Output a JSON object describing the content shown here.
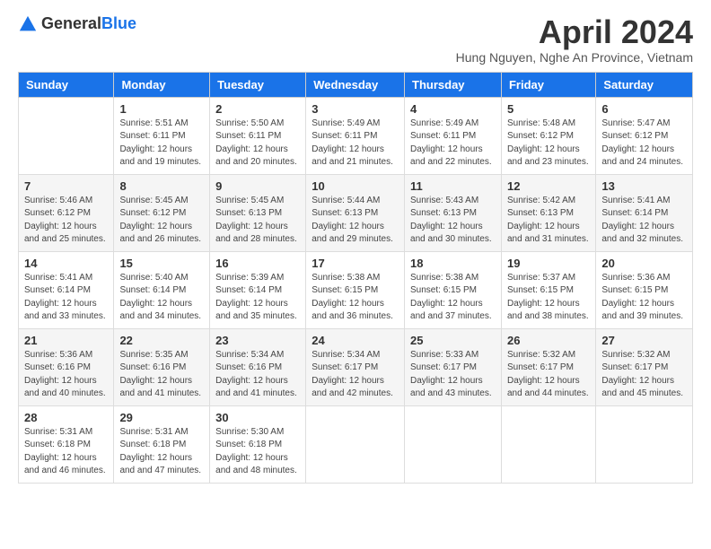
{
  "header": {
    "logo_general": "General",
    "logo_blue": "Blue",
    "month_title": "April 2024",
    "subtitle": "Hung Nguyen, Nghe An Province, Vietnam"
  },
  "weekdays": [
    "Sunday",
    "Monday",
    "Tuesday",
    "Wednesday",
    "Thursday",
    "Friday",
    "Saturday"
  ],
  "weeks": [
    [
      {
        "day": "",
        "sunrise": "",
        "sunset": "",
        "daylight": ""
      },
      {
        "day": "1",
        "sunrise": "Sunrise: 5:51 AM",
        "sunset": "Sunset: 6:11 PM",
        "daylight": "Daylight: 12 hours and 19 minutes."
      },
      {
        "day": "2",
        "sunrise": "Sunrise: 5:50 AM",
        "sunset": "Sunset: 6:11 PM",
        "daylight": "Daylight: 12 hours and 20 minutes."
      },
      {
        "day": "3",
        "sunrise": "Sunrise: 5:49 AM",
        "sunset": "Sunset: 6:11 PM",
        "daylight": "Daylight: 12 hours and 21 minutes."
      },
      {
        "day": "4",
        "sunrise": "Sunrise: 5:49 AM",
        "sunset": "Sunset: 6:11 PM",
        "daylight": "Daylight: 12 hours and 22 minutes."
      },
      {
        "day": "5",
        "sunrise": "Sunrise: 5:48 AM",
        "sunset": "Sunset: 6:12 PM",
        "daylight": "Daylight: 12 hours and 23 minutes."
      },
      {
        "day": "6",
        "sunrise": "Sunrise: 5:47 AM",
        "sunset": "Sunset: 6:12 PM",
        "daylight": "Daylight: 12 hours and 24 minutes."
      }
    ],
    [
      {
        "day": "7",
        "sunrise": "Sunrise: 5:46 AM",
        "sunset": "Sunset: 6:12 PM",
        "daylight": "Daylight: 12 hours and 25 minutes."
      },
      {
        "day": "8",
        "sunrise": "Sunrise: 5:45 AM",
        "sunset": "Sunset: 6:12 PM",
        "daylight": "Daylight: 12 hours and 26 minutes."
      },
      {
        "day": "9",
        "sunrise": "Sunrise: 5:45 AM",
        "sunset": "Sunset: 6:13 PM",
        "daylight": "Daylight: 12 hours and 28 minutes."
      },
      {
        "day": "10",
        "sunrise": "Sunrise: 5:44 AM",
        "sunset": "Sunset: 6:13 PM",
        "daylight": "Daylight: 12 hours and 29 minutes."
      },
      {
        "day": "11",
        "sunrise": "Sunrise: 5:43 AM",
        "sunset": "Sunset: 6:13 PM",
        "daylight": "Daylight: 12 hours and 30 minutes."
      },
      {
        "day": "12",
        "sunrise": "Sunrise: 5:42 AM",
        "sunset": "Sunset: 6:13 PM",
        "daylight": "Daylight: 12 hours and 31 minutes."
      },
      {
        "day": "13",
        "sunrise": "Sunrise: 5:41 AM",
        "sunset": "Sunset: 6:14 PM",
        "daylight": "Daylight: 12 hours and 32 minutes."
      }
    ],
    [
      {
        "day": "14",
        "sunrise": "Sunrise: 5:41 AM",
        "sunset": "Sunset: 6:14 PM",
        "daylight": "Daylight: 12 hours and 33 minutes."
      },
      {
        "day": "15",
        "sunrise": "Sunrise: 5:40 AM",
        "sunset": "Sunset: 6:14 PM",
        "daylight": "Daylight: 12 hours and 34 minutes."
      },
      {
        "day": "16",
        "sunrise": "Sunrise: 5:39 AM",
        "sunset": "Sunset: 6:14 PM",
        "daylight": "Daylight: 12 hours and 35 minutes."
      },
      {
        "day": "17",
        "sunrise": "Sunrise: 5:38 AM",
        "sunset": "Sunset: 6:15 PM",
        "daylight": "Daylight: 12 hours and 36 minutes."
      },
      {
        "day": "18",
        "sunrise": "Sunrise: 5:38 AM",
        "sunset": "Sunset: 6:15 PM",
        "daylight": "Daylight: 12 hours and 37 minutes."
      },
      {
        "day": "19",
        "sunrise": "Sunrise: 5:37 AM",
        "sunset": "Sunset: 6:15 PM",
        "daylight": "Daylight: 12 hours and 38 minutes."
      },
      {
        "day": "20",
        "sunrise": "Sunrise: 5:36 AM",
        "sunset": "Sunset: 6:15 PM",
        "daylight": "Daylight: 12 hours and 39 minutes."
      }
    ],
    [
      {
        "day": "21",
        "sunrise": "Sunrise: 5:36 AM",
        "sunset": "Sunset: 6:16 PM",
        "daylight": "Daylight: 12 hours and 40 minutes."
      },
      {
        "day": "22",
        "sunrise": "Sunrise: 5:35 AM",
        "sunset": "Sunset: 6:16 PM",
        "daylight": "Daylight: 12 hours and 41 minutes."
      },
      {
        "day": "23",
        "sunrise": "Sunrise: 5:34 AM",
        "sunset": "Sunset: 6:16 PM",
        "daylight": "Daylight: 12 hours and 41 minutes."
      },
      {
        "day": "24",
        "sunrise": "Sunrise: 5:34 AM",
        "sunset": "Sunset: 6:17 PM",
        "daylight": "Daylight: 12 hours and 42 minutes."
      },
      {
        "day": "25",
        "sunrise": "Sunrise: 5:33 AM",
        "sunset": "Sunset: 6:17 PM",
        "daylight": "Daylight: 12 hours and 43 minutes."
      },
      {
        "day": "26",
        "sunrise": "Sunrise: 5:32 AM",
        "sunset": "Sunset: 6:17 PM",
        "daylight": "Daylight: 12 hours and 44 minutes."
      },
      {
        "day": "27",
        "sunrise": "Sunrise: 5:32 AM",
        "sunset": "Sunset: 6:17 PM",
        "daylight": "Daylight: 12 hours and 45 minutes."
      }
    ],
    [
      {
        "day": "28",
        "sunrise": "Sunrise: 5:31 AM",
        "sunset": "Sunset: 6:18 PM",
        "daylight": "Daylight: 12 hours and 46 minutes."
      },
      {
        "day": "29",
        "sunrise": "Sunrise: 5:31 AM",
        "sunset": "Sunset: 6:18 PM",
        "daylight": "Daylight: 12 hours and 47 minutes."
      },
      {
        "day": "30",
        "sunrise": "Sunrise: 5:30 AM",
        "sunset": "Sunset: 6:18 PM",
        "daylight": "Daylight: 12 hours and 48 minutes."
      },
      {
        "day": "",
        "sunrise": "",
        "sunset": "",
        "daylight": ""
      },
      {
        "day": "",
        "sunrise": "",
        "sunset": "",
        "daylight": ""
      },
      {
        "day": "",
        "sunrise": "",
        "sunset": "",
        "daylight": ""
      },
      {
        "day": "",
        "sunrise": "",
        "sunset": "",
        "daylight": ""
      }
    ]
  ]
}
